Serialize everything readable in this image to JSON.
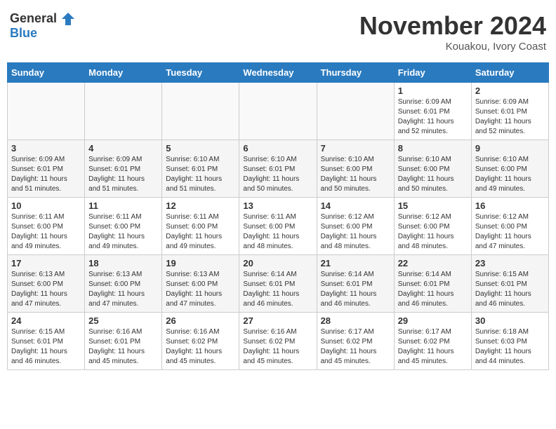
{
  "logo": {
    "text_general": "General",
    "text_blue": "Blue"
  },
  "header": {
    "month": "November 2024",
    "location": "Kouakou, Ivory Coast"
  },
  "weekdays": [
    "Sunday",
    "Monday",
    "Tuesday",
    "Wednesday",
    "Thursday",
    "Friday",
    "Saturday"
  ],
  "weeks": [
    [
      {
        "day": "",
        "info": ""
      },
      {
        "day": "",
        "info": ""
      },
      {
        "day": "",
        "info": ""
      },
      {
        "day": "",
        "info": ""
      },
      {
        "day": "",
        "info": ""
      },
      {
        "day": "1",
        "info": "Sunrise: 6:09 AM\nSunset: 6:01 PM\nDaylight: 11 hours and 52 minutes."
      },
      {
        "day": "2",
        "info": "Sunrise: 6:09 AM\nSunset: 6:01 PM\nDaylight: 11 hours and 52 minutes."
      }
    ],
    [
      {
        "day": "3",
        "info": "Sunrise: 6:09 AM\nSunset: 6:01 PM\nDaylight: 11 hours and 51 minutes."
      },
      {
        "day": "4",
        "info": "Sunrise: 6:09 AM\nSunset: 6:01 PM\nDaylight: 11 hours and 51 minutes."
      },
      {
        "day": "5",
        "info": "Sunrise: 6:10 AM\nSunset: 6:01 PM\nDaylight: 11 hours and 51 minutes."
      },
      {
        "day": "6",
        "info": "Sunrise: 6:10 AM\nSunset: 6:01 PM\nDaylight: 11 hours and 50 minutes."
      },
      {
        "day": "7",
        "info": "Sunrise: 6:10 AM\nSunset: 6:00 PM\nDaylight: 11 hours and 50 minutes."
      },
      {
        "day": "8",
        "info": "Sunrise: 6:10 AM\nSunset: 6:00 PM\nDaylight: 11 hours and 50 minutes."
      },
      {
        "day": "9",
        "info": "Sunrise: 6:10 AM\nSunset: 6:00 PM\nDaylight: 11 hours and 49 minutes."
      }
    ],
    [
      {
        "day": "10",
        "info": "Sunrise: 6:11 AM\nSunset: 6:00 PM\nDaylight: 11 hours and 49 minutes."
      },
      {
        "day": "11",
        "info": "Sunrise: 6:11 AM\nSunset: 6:00 PM\nDaylight: 11 hours and 49 minutes."
      },
      {
        "day": "12",
        "info": "Sunrise: 6:11 AM\nSunset: 6:00 PM\nDaylight: 11 hours and 49 minutes."
      },
      {
        "day": "13",
        "info": "Sunrise: 6:11 AM\nSunset: 6:00 PM\nDaylight: 11 hours and 48 minutes."
      },
      {
        "day": "14",
        "info": "Sunrise: 6:12 AM\nSunset: 6:00 PM\nDaylight: 11 hours and 48 minutes."
      },
      {
        "day": "15",
        "info": "Sunrise: 6:12 AM\nSunset: 6:00 PM\nDaylight: 11 hours and 48 minutes."
      },
      {
        "day": "16",
        "info": "Sunrise: 6:12 AM\nSunset: 6:00 PM\nDaylight: 11 hours and 47 minutes."
      }
    ],
    [
      {
        "day": "17",
        "info": "Sunrise: 6:13 AM\nSunset: 6:00 PM\nDaylight: 11 hours and 47 minutes."
      },
      {
        "day": "18",
        "info": "Sunrise: 6:13 AM\nSunset: 6:00 PM\nDaylight: 11 hours and 47 minutes."
      },
      {
        "day": "19",
        "info": "Sunrise: 6:13 AM\nSunset: 6:00 PM\nDaylight: 11 hours and 47 minutes."
      },
      {
        "day": "20",
        "info": "Sunrise: 6:14 AM\nSunset: 6:01 PM\nDaylight: 11 hours and 46 minutes."
      },
      {
        "day": "21",
        "info": "Sunrise: 6:14 AM\nSunset: 6:01 PM\nDaylight: 11 hours and 46 minutes."
      },
      {
        "day": "22",
        "info": "Sunrise: 6:14 AM\nSunset: 6:01 PM\nDaylight: 11 hours and 46 minutes."
      },
      {
        "day": "23",
        "info": "Sunrise: 6:15 AM\nSunset: 6:01 PM\nDaylight: 11 hours and 46 minutes."
      }
    ],
    [
      {
        "day": "24",
        "info": "Sunrise: 6:15 AM\nSunset: 6:01 PM\nDaylight: 11 hours and 46 minutes."
      },
      {
        "day": "25",
        "info": "Sunrise: 6:16 AM\nSunset: 6:01 PM\nDaylight: 11 hours and 45 minutes."
      },
      {
        "day": "26",
        "info": "Sunrise: 6:16 AM\nSunset: 6:02 PM\nDaylight: 11 hours and 45 minutes."
      },
      {
        "day": "27",
        "info": "Sunrise: 6:16 AM\nSunset: 6:02 PM\nDaylight: 11 hours and 45 minutes."
      },
      {
        "day": "28",
        "info": "Sunrise: 6:17 AM\nSunset: 6:02 PM\nDaylight: 11 hours and 45 minutes."
      },
      {
        "day": "29",
        "info": "Sunrise: 6:17 AM\nSunset: 6:02 PM\nDaylight: 11 hours and 45 minutes."
      },
      {
        "day": "30",
        "info": "Sunrise: 6:18 AM\nSunset: 6:03 PM\nDaylight: 11 hours and 44 minutes."
      }
    ]
  ]
}
